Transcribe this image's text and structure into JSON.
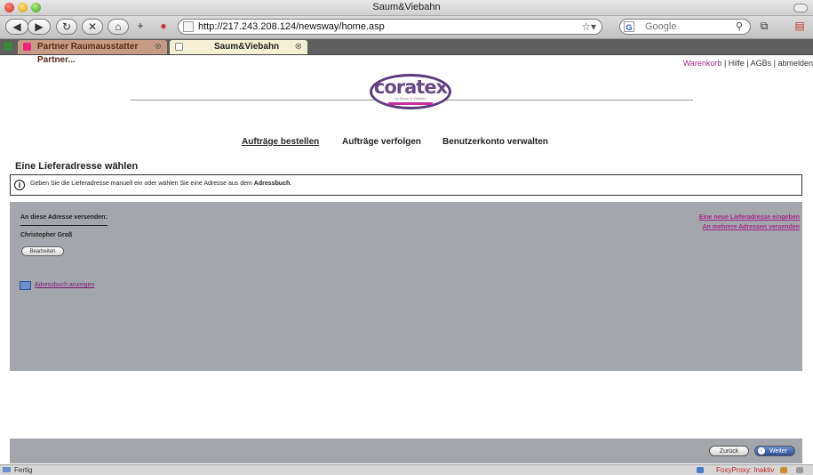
{
  "window": {
    "title": "Saum&Viebahn"
  },
  "toolbar": {
    "url": "http://217.243.208.124/newsway/home.asp",
    "search_placeholder": "Google"
  },
  "tabs": [
    {
      "label": "Partner Raumausstatter Partner..."
    },
    {
      "label": "Saum&Viebahn"
    }
  ],
  "header": {
    "cart": "Warenkorb",
    "links_rest": " | Hilfe | AGBs | abmelden",
    "logo_text": "coratex",
    "logo_sub": "by Saum & Viebahn"
  },
  "nav": {
    "order": "Aufträge bestellen",
    "track": "Aufträge verfolgen",
    "account": "Benutzerkonto verwalten"
  },
  "main": {
    "heading": "Eine Lieferadresse wählen",
    "info_prefix": "Geben Sie die Lieferadresse manuell ein oder wählen Sie eine Adresse aus dem ",
    "info_bold": "Adressbuch",
    "info_suffix": "."
  },
  "panel": {
    "ship_to_label": "An diese Adresse versenden:",
    "recipient_name": "Christopher Groß",
    "edit_button": "Bearbeiten",
    "addressbook_link": "Adressbuch anzeigen",
    "new_address_link": "Eine neue Lieferadresse eingeben",
    "multi_address_link": "An mehrere Adressen versenden"
  },
  "footer": {
    "back_button": "Zurück",
    "next_button": "Weiter"
  },
  "status": {
    "text": "Fertig",
    "foxyproxy": "FoxyProxy: Inaktiv"
  },
  "colors": {
    "link_purple": "#a52a8c",
    "panel_gray": "#a3a6ab",
    "logo_purple": "#6a4a86"
  }
}
